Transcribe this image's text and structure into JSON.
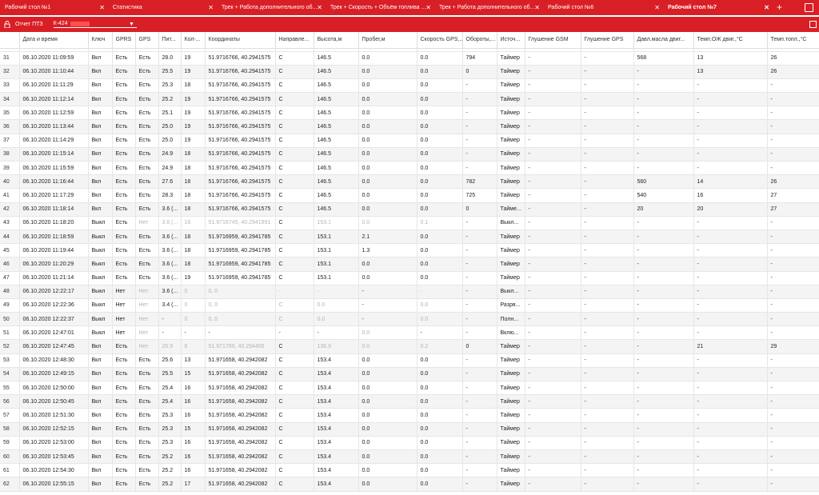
{
  "tabs": [
    {
      "label": "Рабочий стол №1",
      "width": 135
    },
    {
      "label": "Статистика",
      "width": 136
    },
    {
      "label": "Трек + Работа дополнительного об...",
      "width": 136
    },
    {
      "label": "Трек + Скорость + Объём топлива ...",
      "width": 136
    },
    {
      "label": "Трек + Работа дополнительного об...",
      "width": 136
    },
    {
      "label": "Рабочий стол №6",
      "width": 150
    },
    {
      "label": "Рабочий стол №7",
      "width": 137,
      "active": true
    }
  ],
  "tab_close_glyph": "✕",
  "add_tab_glyph": "+",
  "report": {
    "title": "Отчет ПТЗ",
    "vehicle": "К-424"
  },
  "dropdown_glyph": "▼",
  "columns": [
    "",
    "Дата и время",
    "Ключ",
    "GPRS",
    "GPS",
    "Пит...",
    "Кол-...",
    "Координаты",
    "Направле...",
    "Высота,м",
    "Пробег,м",
    "Скорость GPS,...",
    "Обороты,...",
    "Источ...",
    "Глушение GSM",
    "Глушение GPS",
    "Давл.масла двиг...",
    "Темп.ОЖ двиг.,°C",
    "Темп.топл.,°C"
  ],
  "rows": [
    [
      "31",
      "06.10.2020 11:09:59",
      "Вкл",
      "Есть",
      "Есть",
      "28.0",
      "19",
      "51.9716766, 40.2941575",
      "С",
      "146.5",
      "0.0",
      "0.0",
      "794",
      "Таймер",
      "-",
      "-",
      "568",
      "13",
      "26"
    ],
    [
      "32",
      "06.10.2020 11:10:44",
      "Вкл",
      "Есть",
      "Есть",
      "25.5",
      "19",
      "51.9716766, 40.2941575",
      "С",
      "146.5",
      "0.0",
      "0.0",
      "0",
      "Таймер",
      "-",
      "-",
      "-",
      "13",
      "26"
    ],
    [
      "33",
      "06.10.2020 11:11:29",
      "Вкл",
      "Есть",
      "Есть",
      "25.3",
      "18",
      "51.9716766, 40.2941575",
      "С",
      "146.5",
      "0.0",
      "0.0",
      "-",
      "Таймер",
      "-",
      "-",
      "-",
      "-",
      "-"
    ],
    [
      "34",
      "06.10.2020 11:12:14",
      "Вкл",
      "Есть",
      "Есть",
      "25.2",
      "19",
      "51.9716766, 40.2941575",
      "С",
      "146.5",
      "0.0",
      "0.0",
      "-",
      "Таймер",
      "-",
      "-",
      "-",
      "-",
      "-"
    ],
    [
      "35",
      "06.10.2020 11:12:59",
      "Вкл",
      "Есть",
      "Есть",
      "25.1",
      "19",
      "51.9716766, 40.2941575",
      "С",
      "146.5",
      "0.0",
      "0.0",
      "-",
      "Таймер",
      "-",
      "-",
      "-",
      "-",
      "-"
    ],
    [
      "36",
      "06.10.2020 11:13:44",
      "Вкл",
      "Есть",
      "Есть",
      "25.0",
      "19",
      "51.9716766, 40.2941575",
      "С",
      "146.5",
      "0.0",
      "0.0",
      "-",
      "Таймер",
      "-",
      "-",
      "-",
      "-",
      "-"
    ],
    [
      "37",
      "06.10.2020 11:14:29",
      "Вкл",
      "Есть",
      "Есть",
      "25.0",
      "19",
      "51.9716766, 40.2941575",
      "С",
      "146.5",
      "0.0",
      "0.0",
      "-",
      "Таймер",
      "-",
      "-",
      "-",
      "-",
      "-"
    ],
    [
      "38",
      "06.10.2020 11:15:14",
      "Вкл",
      "Есть",
      "Есть",
      "24.9",
      "18",
      "51.9716766, 40.2941575",
      "С",
      "146.5",
      "0.0",
      "0.0",
      "-",
      "Таймер",
      "-",
      "-",
      "-",
      "-",
      "-"
    ],
    [
      "39",
      "06.10.2020 11:15:59",
      "Вкл",
      "Есть",
      "Есть",
      "24.9",
      "18",
      "51.9716766, 40.2941575",
      "С",
      "146.5",
      "0.0",
      "0.0",
      "-",
      "Таймер",
      "-",
      "-",
      "-",
      "-",
      "-"
    ],
    [
      "40",
      "06.10.2020 11:16:44",
      "Вкл",
      "Есть",
      "Есть",
      "27.6",
      "18",
      "51.9716766, 40.2941575",
      "С",
      "146.5",
      "0.0",
      "0.0",
      "782",
      "Таймер",
      "-",
      "-",
      "560",
      "14",
      "26"
    ],
    [
      "41",
      "06.10.2020 11:17:29",
      "Вкл",
      "Есть",
      "Есть",
      "28.3",
      "18",
      "51.9716766, 40.2941575",
      "С",
      "146.5",
      "0.0",
      "0.0",
      "725",
      "Таймер",
      "-",
      "-",
      "540",
      "16",
      "27"
    ],
    [
      "42",
      "06.10.2020 11:18:14",
      "Вкл",
      "Есть",
      "Есть",
      "3.6 (...",
      "18",
      "51.9716766, 40.2941575",
      "С",
      "146.5",
      "0.0",
      "0.0",
      "0",
      "Тайме...",
      "-",
      "-",
      "20",
      "20",
      "27"
    ],
    [
      "43",
      "06.10.2020 11:18:20",
      "Выкл",
      "Есть",
      "Нет",
      "3.6 (...",
      "16",
      "51.9716745, 40.2941991",
      "С",
      "153.1",
      "0.0",
      "0.1",
      "-",
      "Выкл...",
      "-",
      "-",
      "-",
      "-",
      "-"
    ],
    [
      "44",
      "06.10.2020 11:18:59",
      "Выкл",
      "Есть",
      "Есть",
      "3.6 (...",
      "18",
      "51.9716959, 40.2941785",
      "С",
      "153.1",
      "2.1",
      "0.0",
      "-",
      "Таймер",
      "-",
      "-",
      "-",
      "-",
      "-"
    ],
    [
      "45",
      "06.10.2020 11:19:44",
      "Выкл",
      "Есть",
      "Есть",
      "3.6 (...",
      "18",
      "51.9716959, 40.2941785",
      "С",
      "153.1",
      "1.3",
      "0.0",
      "-",
      "Таймер",
      "-",
      "-",
      "-",
      "-",
      "-"
    ],
    [
      "46",
      "06.10.2020 11:20:29",
      "Выкл",
      "Есть",
      "Есть",
      "3.6 (...",
      "18",
      "51.9716959, 40.2941785",
      "С",
      "153.1",
      "0.0",
      "0.0",
      "-",
      "Таймер",
      "-",
      "-",
      "-",
      "-",
      "-"
    ],
    [
      "47",
      "06.10.2020 11:21:14",
      "Выкл",
      "Есть",
      "Есть",
      "3.6 (...",
      "19",
      "51.9716959, 40.2941785",
      "С",
      "153.1",
      "0.0",
      "0.0",
      "-",
      "Таймер",
      "-",
      "-",
      "-",
      "-",
      "-"
    ],
    [
      "48",
      "06.10.2020 12:22:17",
      "Выкл",
      "Нет",
      "Нет",
      "3.6 (...",
      "0",
      "0, 0",
      "-",
      "-",
      "-",
      "-",
      "-",
      "Выкл...",
      "-",
      "-",
      "-",
      "-",
      "-"
    ],
    [
      "49",
      "06.10.2020 12:22:36",
      "Выкл",
      "Нет",
      "Нет",
      "3.4 (...",
      "0",
      "0, 0",
      "С",
      "0.0",
      "-",
      "0.0",
      "-",
      "Разря...",
      "-",
      "-",
      "-",
      "-",
      "-"
    ],
    [
      "50",
      "06.10.2020 12:22:37",
      "Выкл",
      "Нет",
      "Нет",
      "-",
      "0",
      "0, 0",
      "С",
      "0.0",
      "-",
      "0.0",
      "-",
      "Полн...",
      "-",
      "-",
      "-",
      "-",
      "-"
    ],
    [
      "51",
      "06.10.2020 12:47:01",
      "Выкл",
      "Нет",
      "Нет",
      "-",
      "-",
      "-",
      "-",
      "-",
      "0.0",
      "-",
      "-",
      "Вклю...",
      "-",
      "-",
      "-",
      "-",
      "-"
    ],
    [
      "52",
      "06.10.2020 12:47:45",
      "Вкл",
      "Есть",
      "Нет",
      "25.9",
      "6",
      "51.971789, 40.294406",
      "С",
      "136.9",
      "0.0",
      "0.2",
      "0",
      "Таймер",
      "-",
      "-",
      "-",
      "21",
      "29"
    ],
    [
      "53",
      "06.10.2020 12:48:30",
      "Вкл",
      "Есть",
      "Есть",
      "25.6",
      "13",
      "51.971658, 40.2942082",
      "С",
      "153.4",
      "0.0",
      "0.0",
      "-",
      "Таймер",
      "-",
      "-",
      "-",
      "-",
      "-"
    ],
    [
      "54",
      "06.10.2020 12:49:15",
      "Вкл",
      "Есть",
      "Есть",
      "25.5",
      "15",
      "51.971658, 40.2942082",
      "С",
      "153.4",
      "0.0",
      "0.0",
      "-",
      "Таймер",
      "-",
      "-",
      "-",
      "-",
      "-"
    ],
    [
      "55",
      "06.10.2020 12:50:00",
      "Вкл",
      "Есть",
      "Есть",
      "25.4",
      "16",
      "51.971658, 40.2942082",
      "С",
      "153.4",
      "0.0",
      "0.0",
      "-",
      "Таймер",
      "-",
      "-",
      "-",
      "-",
      "-"
    ],
    [
      "56",
      "06.10.2020 12:50:45",
      "Вкл",
      "Есть",
      "Есть",
      "25.4",
      "16",
      "51.971658, 40.2942082",
      "С",
      "153.4",
      "0.0",
      "0.0",
      "-",
      "Таймер",
      "-",
      "-",
      "-",
      "-",
      "-"
    ],
    [
      "57",
      "06.10.2020 12:51:30",
      "Вкл",
      "Есть",
      "Есть",
      "25.3",
      "16",
      "51.971658, 40.2942082",
      "С",
      "153.4",
      "0.0",
      "0.0",
      "-",
      "Таймер",
      "-",
      "-",
      "-",
      "-",
      "-"
    ],
    [
      "58",
      "06.10.2020 12:52:15",
      "Вкл",
      "Есть",
      "Есть",
      "25.3",
      "15",
      "51.971658, 40.2942082",
      "С",
      "153.4",
      "0.0",
      "0.0",
      "-",
      "Таймер",
      "-",
      "-",
      "-",
      "-",
      "-"
    ],
    [
      "59",
      "06.10.2020 12:53:00",
      "Вкл",
      "Есть",
      "Есть",
      "25.3",
      "16",
      "51.971658, 40.2942082",
      "С",
      "153.4",
      "0.0",
      "0.0",
      "-",
      "Таймер",
      "-",
      "-",
      "-",
      "-",
      "-"
    ],
    [
      "60",
      "06.10.2020 12:53:45",
      "Вкл",
      "Есть",
      "Есть",
      "25.2",
      "16",
      "51.971658, 40.2942082",
      "С",
      "153.4",
      "0.0",
      "0.0",
      "-",
      "Таймер",
      "-",
      "-",
      "-",
      "-",
      "-"
    ],
    [
      "61",
      "06.10.2020 12:54:30",
      "Вкл",
      "Есть",
      "Есть",
      "25.2",
      "16",
      "51.971658, 40.2942082",
      "С",
      "153.4",
      "0.0",
      "0.0",
      "-",
      "Таймер",
      "-",
      "-",
      "-",
      "-",
      "-"
    ],
    [
      "62",
      "06.10.2020 12:55:15",
      "Вкл",
      "Есть",
      "Есть",
      "25.2",
      "17",
      "51.971658, 40.2942082",
      "С",
      "153.4",
      "0.0",
      "0.0",
      "-",
      "Таймер",
      "-",
      "-",
      "-",
      "-",
      "-"
    ]
  ],
  "dim_rows": [
    "43",
    "52"
  ],
  "colors": {
    "accent": "#d91f26",
    "dim_text": "#b5b5b5"
  }
}
